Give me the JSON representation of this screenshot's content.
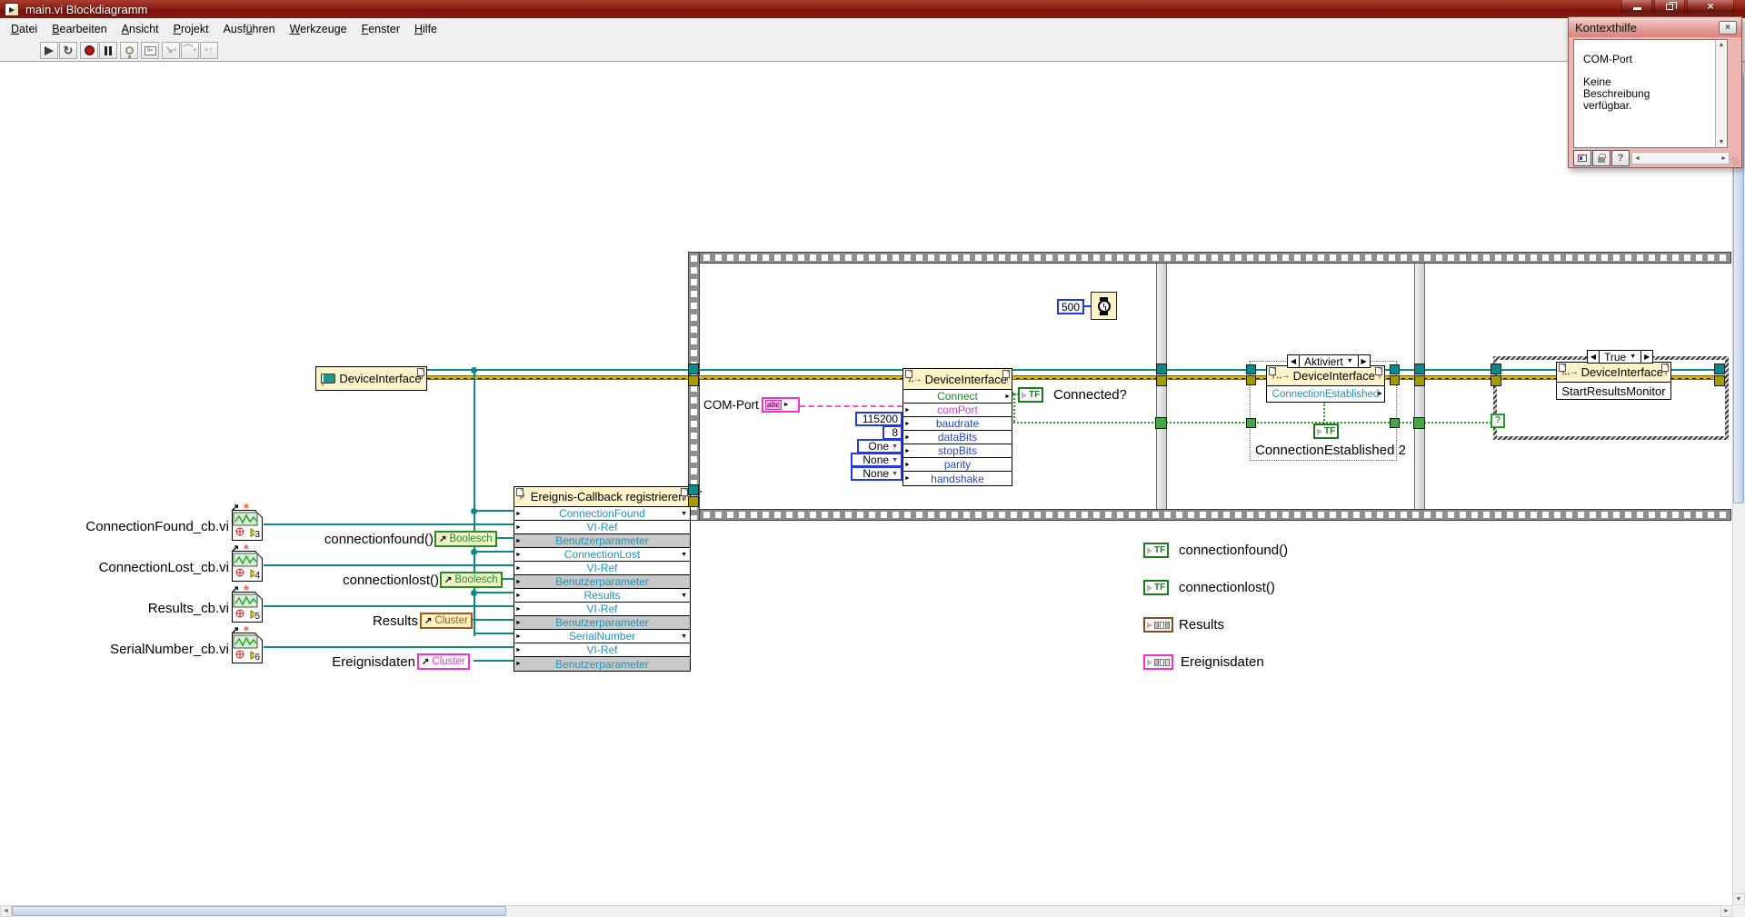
{
  "window": {
    "title": "main.vi Blockdiagramm"
  },
  "menu": {
    "items": [
      {
        "pre": "",
        "u": "D",
        "rest": "atei"
      },
      {
        "pre": "",
        "u": "B",
        "rest": "earbeiten"
      },
      {
        "pre": "",
        "u": "A",
        "rest": "nsicht"
      },
      {
        "pre": "",
        "u": "P",
        "rest": "rojekt"
      },
      {
        "pre": "Ausf",
        "u": "ü",
        "rest": "hren"
      },
      {
        "pre": "",
        "u": "W",
        "rest": "erkzeuge"
      },
      {
        "pre": "",
        "u": "F",
        "rest": "enster"
      },
      {
        "pre": "",
        "u": "H",
        "rest": "ilfe"
      }
    ]
  },
  "toolbar": {
    "buttons": [
      "run",
      "run-continuously",
      "abort-execution",
      "pause",
      "highlight-execution",
      "retain-wire-values",
      "step-into",
      "step-over",
      "step-out"
    ]
  },
  "context_help": {
    "title": "Kontexthilfe",
    "heading": "COM-Port",
    "body": "Keine Beschreibung verfügbar."
  },
  "diagram": {
    "device_constant": {
      "label": "DeviceInterface"
    },
    "register_node": {
      "title": "Ereignis-Callback registrieren",
      "rows": [
        "ConnectionFound",
        "VI-Ref",
        "Benutzerparameter",
        "ConnectionLost",
        "VI-Ref",
        "Benutzerparameter",
        "Results",
        "VI-Ref",
        "Benutzerparameter",
        "SerialNumber",
        "VI-Ref",
        "Benutzerparameter"
      ]
    },
    "vi_refs": [
      {
        "label": "ConnectionFound_cb.vi",
        "num": "3"
      },
      {
        "label": "ConnectionLost_cb.vi",
        "num": "4"
      },
      {
        "label": "Results_cb.vi",
        "num": "5"
      },
      {
        "label": "SerialNumber_cb.vi",
        "num": "6"
      }
    ],
    "ctl_refs": [
      {
        "label": "connectionfound()",
        "type": "Boolesch"
      },
      {
        "label": "connectionlost()",
        "type": "Boolesch"
      },
      {
        "label": "Results",
        "type": "Cluster"
      },
      {
        "label": "Ereignisdaten",
        "type": "Cluster"
      }
    ],
    "com_port": {
      "label": "COM-Port",
      "glyph": "abc"
    },
    "connect_node": {
      "title": "DeviceInterface",
      "method": "Connect",
      "params": [
        "comPort",
        "baudrate",
        "dataBits",
        "stopBits",
        "parity",
        "handshake"
      ]
    },
    "param_values": {
      "baudrate": "115200",
      "dataBits": "8",
      "stopBits": "One",
      "parity": "None",
      "handshake": "None"
    },
    "wait": {
      "value": "500"
    },
    "connected": {
      "label": "Connected?",
      "glyph": "TF"
    },
    "disable_structure": {
      "selector": "Aktiviert"
    },
    "property_node": {
      "title": "DeviceInterface",
      "property": "ConnectionEstablished"
    },
    "ce_indicator": {
      "label": "ConnectionEstablished 2",
      "glyph": "TF"
    },
    "case_structure": {
      "selector": "True"
    },
    "monitor_node": {
      "title": "DeviceInterface",
      "method": "StartResultsMonitor"
    },
    "event_indicators": [
      {
        "label": "connectionfound()",
        "glyph": "TF"
      },
      {
        "label": "connectionlost()",
        "glyph": "TF"
      },
      {
        "label": "Results"
      },
      {
        "label": "Ereignisdaten"
      }
    ]
  },
  "colors": {
    "titlebar_red": "#8b1a12",
    "wire_refnum_teal": "#0c8a8a",
    "wire_error_yellow": "#d8b70a",
    "wire_boolean_green": "#22a022",
    "wire_string_pink": "#f050d0",
    "wire_numeric_blue": "#2038e8",
    "node_header_yellow": "#fcf3c8",
    "param_row_gray": "#c9c9c9",
    "node_row_teal": "#2293b5",
    "context_help_pink": "#e8a49f"
  }
}
